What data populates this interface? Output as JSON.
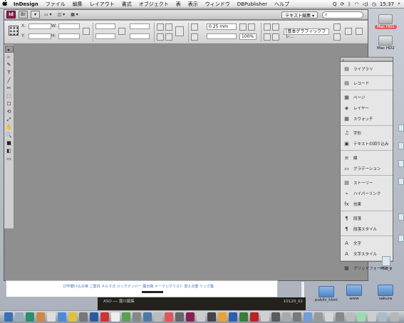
{
  "menubar": {
    "apple": "",
    "app": "InDesign",
    "items": [
      "ファイル",
      "編集",
      "レイアウト",
      "書式",
      "オブジェクト",
      "表",
      "表示",
      "ウィンドウ",
      "DBPublisher",
      "ヘルプ"
    ],
    "clock": "15:37"
  },
  "appbar": {
    "logo": "Id",
    "bridge": "Br",
    "workspace": "テキスト編集 ▾"
  },
  "control": {
    "x_label": "X:",
    "y_label": "Y:",
    "w_label": "W:",
    "h_label": "H:",
    "stroke_weight": "0.25 mm",
    "zoom": "100%",
    "style_select": "[基本グラフィックフレ…"
  },
  "tools": [
    "▸",
    "▹",
    "✎",
    "T",
    "╱",
    "✂",
    "⬚",
    "☐",
    "⟲",
    "⤢",
    "✋",
    "🔍",
    "■",
    "◧",
    "▭"
  ],
  "panel": {
    "groups": [
      [
        {
          "icon": "▤",
          "label": "ライブラリ"
        }
      ],
      [
        {
          "icon": "▤",
          "label": "レコード"
        }
      ],
      [
        {
          "icon": "▦",
          "label": "ページ"
        },
        {
          "icon": "◈",
          "label": "レイヤー"
        },
        {
          "icon": "▦",
          "label": "スウォッチ"
        }
      ],
      [
        {
          "icon": "♫",
          "label": "字形"
        },
        {
          "icon": "▣",
          "label": "テキストの回り込み"
        }
      ],
      [
        {
          "icon": "≡",
          "label": "線"
        },
        {
          "icon": "▭",
          "label": "グラデーション"
        }
      ],
      [
        {
          "icon": "▤",
          "label": "ストーリー"
        },
        {
          "icon": "⌁",
          "label": "ハイパーリンク"
        },
        {
          "icon": "fx",
          "label": "効果"
        }
      ],
      [
        {
          "icon": "¶",
          "label": "段落"
        },
        {
          "icon": "¶",
          "label": "段落スタイル"
        }
      ],
      [
        {
          "icon": "A",
          "label": "文字"
        },
        {
          "icon": "A",
          "label": "文字スタイル"
        }
      ],
      [
        {
          "icon": "▦",
          "label": "グリッドフォーマット"
        }
      ]
    ]
  },
  "desktop": {
    "disk1": "Mac HD1",
    "disk2": "Mac HD2",
    "folder1": "public_html",
    "folder2": "www",
    "folder3": "sakura",
    "side_label": "PSB_z"
  },
  "background": {
    "nav": "DTP磨け込み帝 ご案内 メルマガ バックナンバー 展示館 メーリングリスト 替えの部 リンク集",
    "aso": "ASO ── 瀧川編集",
    "aso_right": "10120_02"
  },
  "colors": {
    "indesign": "#8a1f4f",
    "canvas": "#8f8f8f",
    "disk_label_red": "#e05c5c"
  }
}
